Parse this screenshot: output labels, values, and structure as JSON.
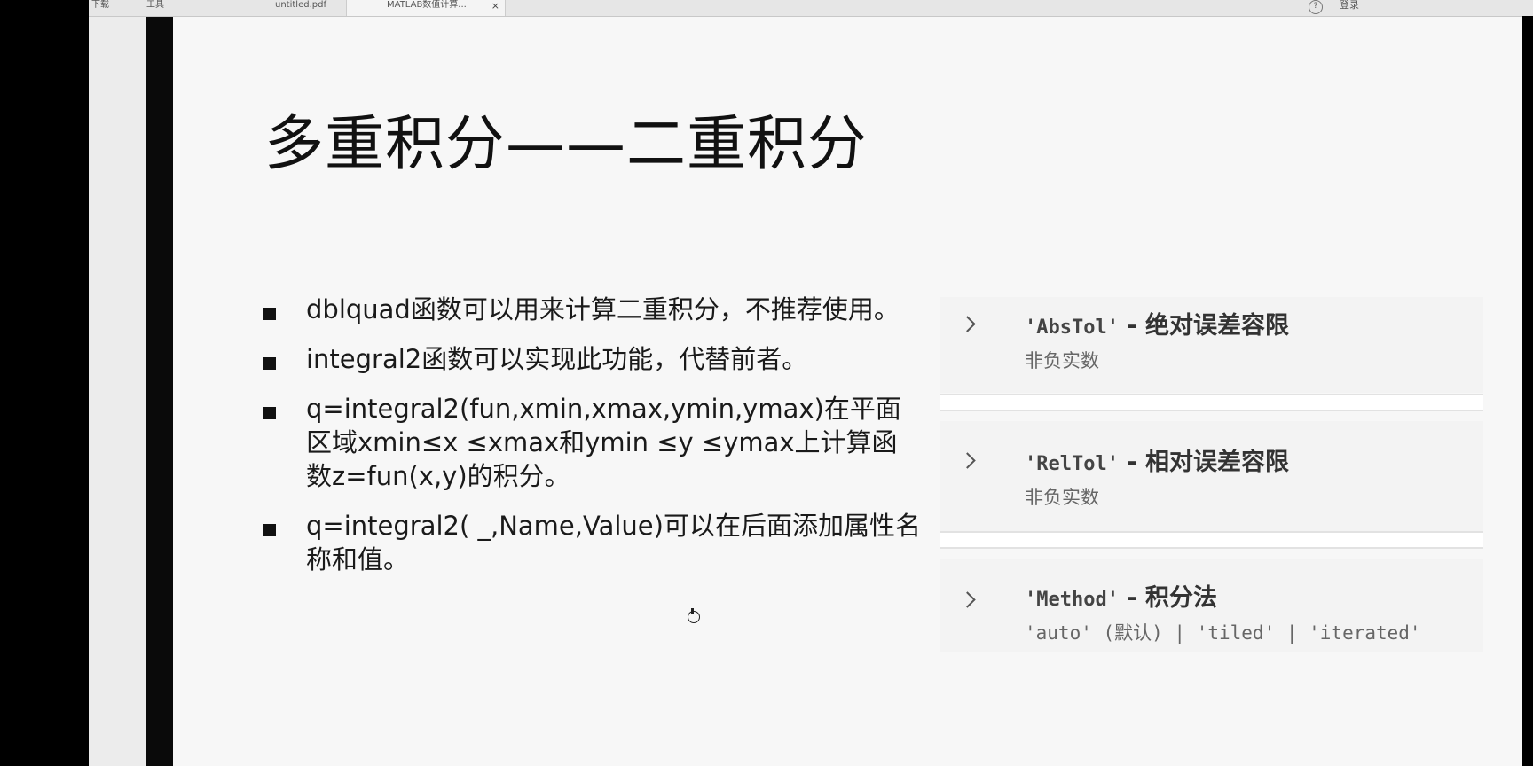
{
  "tabs": [
    {
      "label": "下载"
    },
    {
      "label": "工具"
    },
    {
      "label": "untitled.pdf"
    },
    {
      "label": "MATLAB数值计算..."
    }
  ],
  "window": {
    "login_label": "登录",
    "help_icon": "help-icon"
  },
  "slide": {
    "title": "多重积分——二重积分",
    "bullets": [
      "dblquad函数可以用来计算二重积分，不推荐使用。",
      "integral2函数可以实现此功能，代替前者。",
      "q=integral2(fun,xmin,xmax,ymin,ymax)在平面区域xmin≤x ≤xmax和ymin ≤y ≤ymax上计算函数z=fun(x,y)的积分。",
      "q=integral2( _,Name,Value)可以在后面添加属性名称和值。"
    ]
  },
  "params": [
    {
      "code": "'AbsTol'",
      "label": " - 绝对误差容限",
      "desc": "非负实数"
    },
    {
      "code": "'RelTol'",
      "label": " - 相对误差容限",
      "desc": "非负实数"
    },
    {
      "code": "'Method'",
      "label": " - 积分法",
      "desc": "'auto' (默认) | 'tiled' | 'iterated'"
    }
  ]
}
